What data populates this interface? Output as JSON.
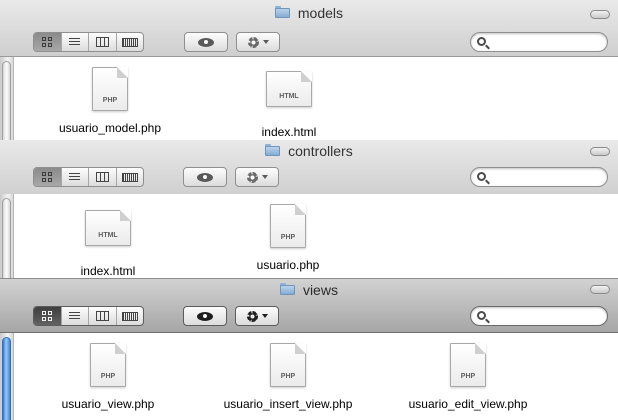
{
  "windows": [
    {
      "title": "models",
      "search": {
        "placeholder": "",
        "value": ""
      },
      "files": [
        {
          "name": "usuario_model.php",
          "type": "PHP"
        },
        {
          "name": "index.html",
          "type": "HTML"
        }
      ]
    },
    {
      "title": "controllers",
      "search": {
        "placeholder": "",
        "value": ""
      },
      "files": [
        {
          "name": "index.html",
          "type": "HTML"
        },
        {
          "name": "usuario.php",
          "type": "PHP"
        }
      ]
    },
    {
      "title": "views",
      "search": {
        "placeholder": "",
        "value": ""
      },
      "files": [
        {
          "name": "usuario_view.php",
          "type": "PHP"
        },
        {
          "name": "usuario_insert_view.php",
          "type": "PHP"
        },
        {
          "name": "usuario_edit_view.php",
          "type": "PHP"
        }
      ]
    }
  ],
  "view_modes": [
    "icon-view",
    "list-view",
    "column-view",
    "cover-flow-view"
  ],
  "active_view_mode": "icon-view",
  "active_window": "views",
  "icons": {
    "folder": "folder-icon",
    "quick_look": "eye-icon",
    "action": "gear-icon",
    "search": "search-icon",
    "document": "document-icon"
  },
  "colors": {
    "toolbar_inactive": "#dcdcdc",
    "toolbar_active": "#b3b3b3",
    "scroll_active": "#4a8fe3"
  }
}
